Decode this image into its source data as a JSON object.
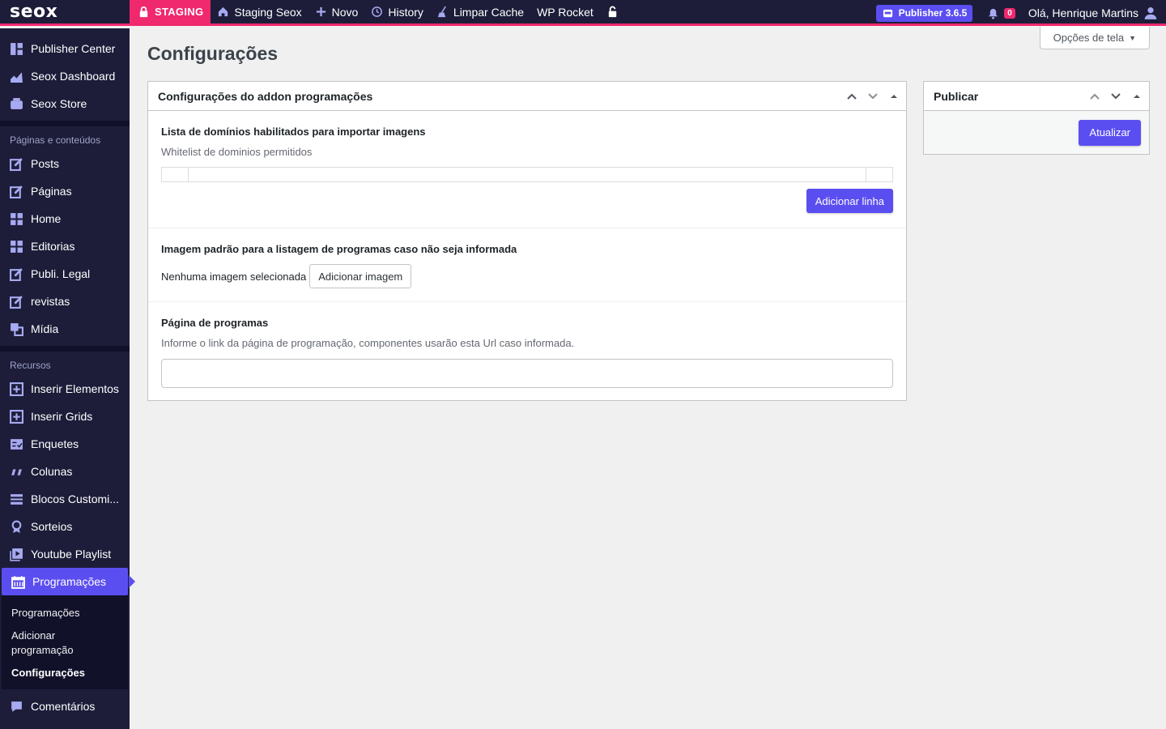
{
  "adminbar": {
    "logo": "seox",
    "staging": "STAGING",
    "site": "Staging Seox",
    "new": "Novo",
    "history": "History",
    "cache": "Limpar Cache",
    "rocket": "WP Rocket",
    "publisher": "Publisher 3.6.5",
    "notifications": "0",
    "greeting": "Olá, Henrique Martins"
  },
  "sidebar": {
    "top_items": [
      {
        "label": "Publisher Center",
        "icon": "grid-icon"
      },
      {
        "label": "Seox Dashboard",
        "icon": "chart-icon"
      },
      {
        "label": "Seox Store",
        "icon": "store-icon"
      }
    ],
    "heading_pages": "Páginas e conteúdos",
    "page_items": [
      {
        "label": "Posts",
        "icon": "edit-icon"
      },
      {
        "label": "Páginas",
        "icon": "edit-icon"
      },
      {
        "label": "Home",
        "icon": "blocks-icon"
      },
      {
        "label": "Editorias",
        "icon": "blocks-icon"
      },
      {
        "label": "Publi. Legal",
        "icon": "edit-icon"
      },
      {
        "label": "revistas",
        "icon": "edit-icon"
      },
      {
        "label": "Mídia",
        "icon": "media-icon"
      }
    ],
    "heading_resources": "Recursos",
    "resource_items": [
      {
        "label": "Inserir Elementos",
        "icon": "plus-square-icon"
      },
      {
        "label": "Inserir Grids",
        "icon": "plus-square-icon"
      },
      {
        "label": "Enquetes",
        "icon": "poll-icon"
      },
      {
        "label": "Colunas",
        "icon": "quote-icon"
      },
      {
        "label": "Blocos Customi...",
        "icon": "layout-icon"
      },
      {
        "label": "Sorteios",
        "icon": "award-icon"
      },
      {
        "label": "Youtube Playlist",
        "icon": "video-icon"
      }
    ],
    "active_item": "Programações",
    "submenu": [
      "Programações",
      "Adicionar programação",
      "Configurações"
    ],
    "bottom_item": "Comentários"
  },
  "main": {
    "screen_options": "Opções de tela",
    "title": "Configurações",
    "settings_box": {
      "title": "Configurações do addon programações",
      "field1_label": "Lista de domínios habilitados para importar imagens",
      "field1_desc": "Whitelist de dominios permitidos",
      "add_row": "Adicionar linha",
      "field2_label": "Imagem padrão para a listagem de programas caso não seja informada",
      "no_image": "Nenhuma imagem selecionada",
      "add_image": "Adicionar imagem",
      "field3_label": "Página de programas",
      "field3_desc": "Informe o link da página de programação, componentes usarão esta Url caso informada.",
      "field3_value": ""
    },
    "publish_box": {
      "title": "Publicar",
      "update": "Atualizar"
    }
  },
  "colors": {
    "accent": "#5b4ef0",
    "staging": "#f0286e",
    "sidebar": "#1d1d3a"
  }
}
